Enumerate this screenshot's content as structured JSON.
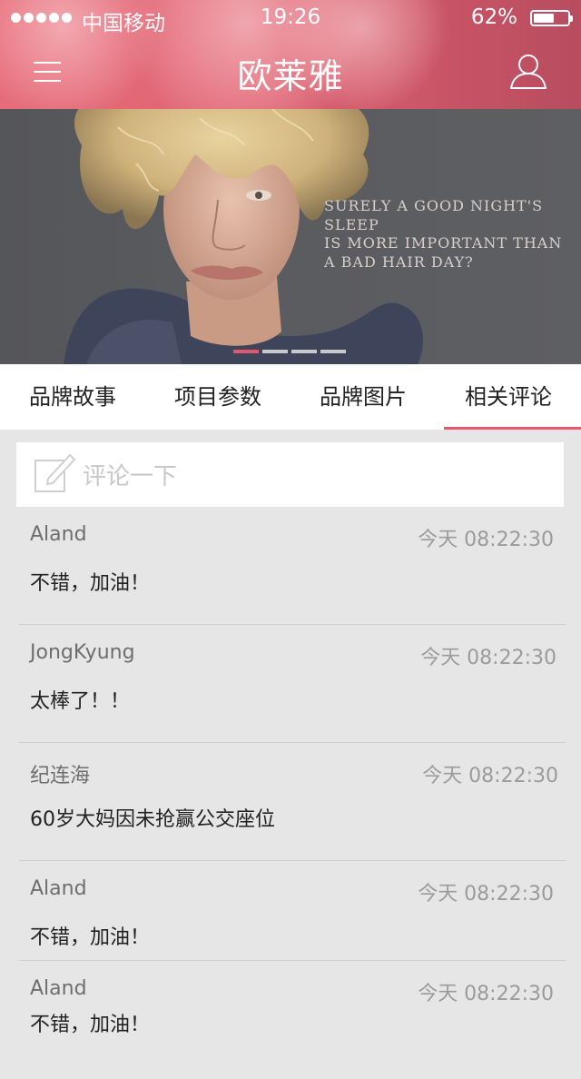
{
  "status": {
    "carrier": "中国移动",
    "time": "19:26",
    "battery_percent": "62%",
    "battery_level": 0.62
  },
  "nav": {
    "title": "欧莱雅",
    "menu_icon": "menu-icon",
    "user_icon": "user-icon"
  },
  "banner": {
    "caption": "Surely a good night's sleep\nis more important than\na bad hair day?",
    "slides": 4,
    "active_slide": 1
  },
  "tabs": [
    {
      "label": "品牌故事"
    },
    {
      "label": "项目参数"
    },
    {
      "label": "品牌图片"
    },
    {
      "label": "相关评论"
    }
  ],
  "comment_input": {
    "placeholder": "评论一下",
    "icon": "edit-icon"
  },
  "comments": [
    {
      "user": "Aland",
      "time": "今天 08:22:30",
      "text": "不错，加油！"
    },
    {
      "user": "JongKyung",
      "time": "今天 08:22:30",
      "text": "太棒了！！"
    },
    {
      "user": "纪连海",
      "time": "今天 08:22:30",
      "text": "60岁大妈因未抢赢公交座位"
    },
    {
      "user": "Aland",
      "time": "今天 08:22:30",
      "text": "不错，加油！"
    },
    {
      "user": "Aland",
      "time": "今天 08:22:30",
      "text": "不错，加油！"
    }
  ],
  "colors": {
    "accent": "#e8566b",
    "header": "#d9606f",
    "background": "#e6e6e6"
  }
}
